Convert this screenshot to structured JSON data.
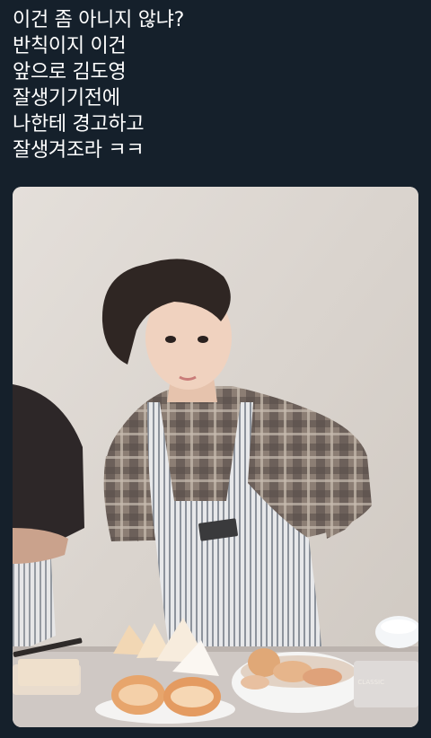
{
  "tweet": {
    "lines": [
      "이건 좀 아니지 않냐?",
      "반칙이지 이건",
      "앞으로 김도영",
      "잘생기기전에",
      "나한테 경고하고",
      "잘생겨조라 ㅋㅋ"
    ]
  },
  "photo": {
    "watermark": "CLASSIC"
  },
  "colors": {
    "background": "#15202b",
    "text": "#ffffff"
  }
}
